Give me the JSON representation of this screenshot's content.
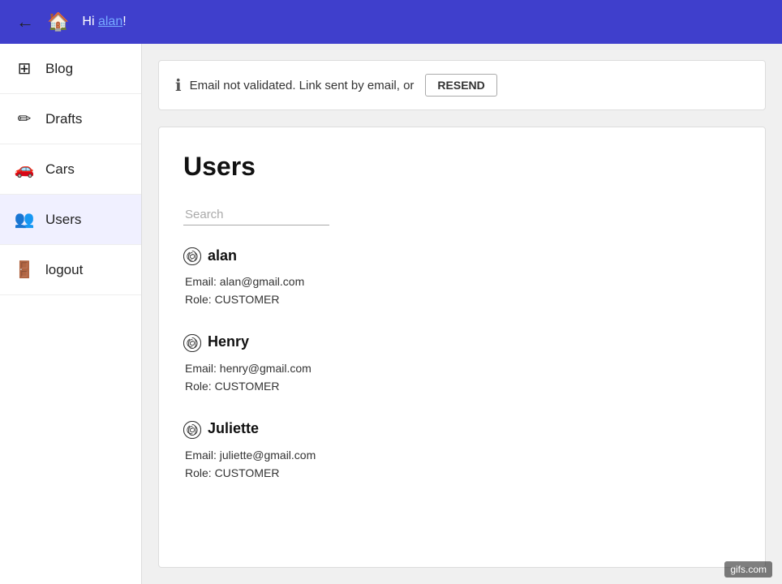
{
  "topbar": {
    "greeting_prefix": "Hi ",
    "username": "alan",
    "greeting_suffix": "!"
  },
  "sidebar": {
    "items": [
      {
        "id": "blog",
        "label": "Blog",
        "icon": "⊞"
      },
      {
        "id": "drafts",
        "label": "Drafts",
        "icon": "✏"
      },
      {
        "id": "cars",
        "label": "Cars",
        "icon": "🚗"
      },
      {
        "id": "users",
        "label": "Users",
        "icon": "👥"
      },
      {
        "id": "logout",
        "label": "logout",
        "icon": "🚪"
      }
    ]
  },
  "alert": {
    "message": "Email not validated. Link sent by email, or",
    "resend_label": "RESEND"
  },
  "users_panel": {
    "title": "Users",
    "search_placeholder": "Search",
    "users": [
      {
        "name": "alan",
        "email": "alan@gmail.com",
        "role": "CUSTOMER"
      },
      {
        "name": "Henry",
        "email": "henry@gmail.com",
        "role": "CUSTOMER"
      },
      {
        "name": "Juliette",
        "email": "juliette@gmail.com",
        "role": "CUSTOMER"
      }
    ]
  },
  "watermark": "gifs.com"
}
